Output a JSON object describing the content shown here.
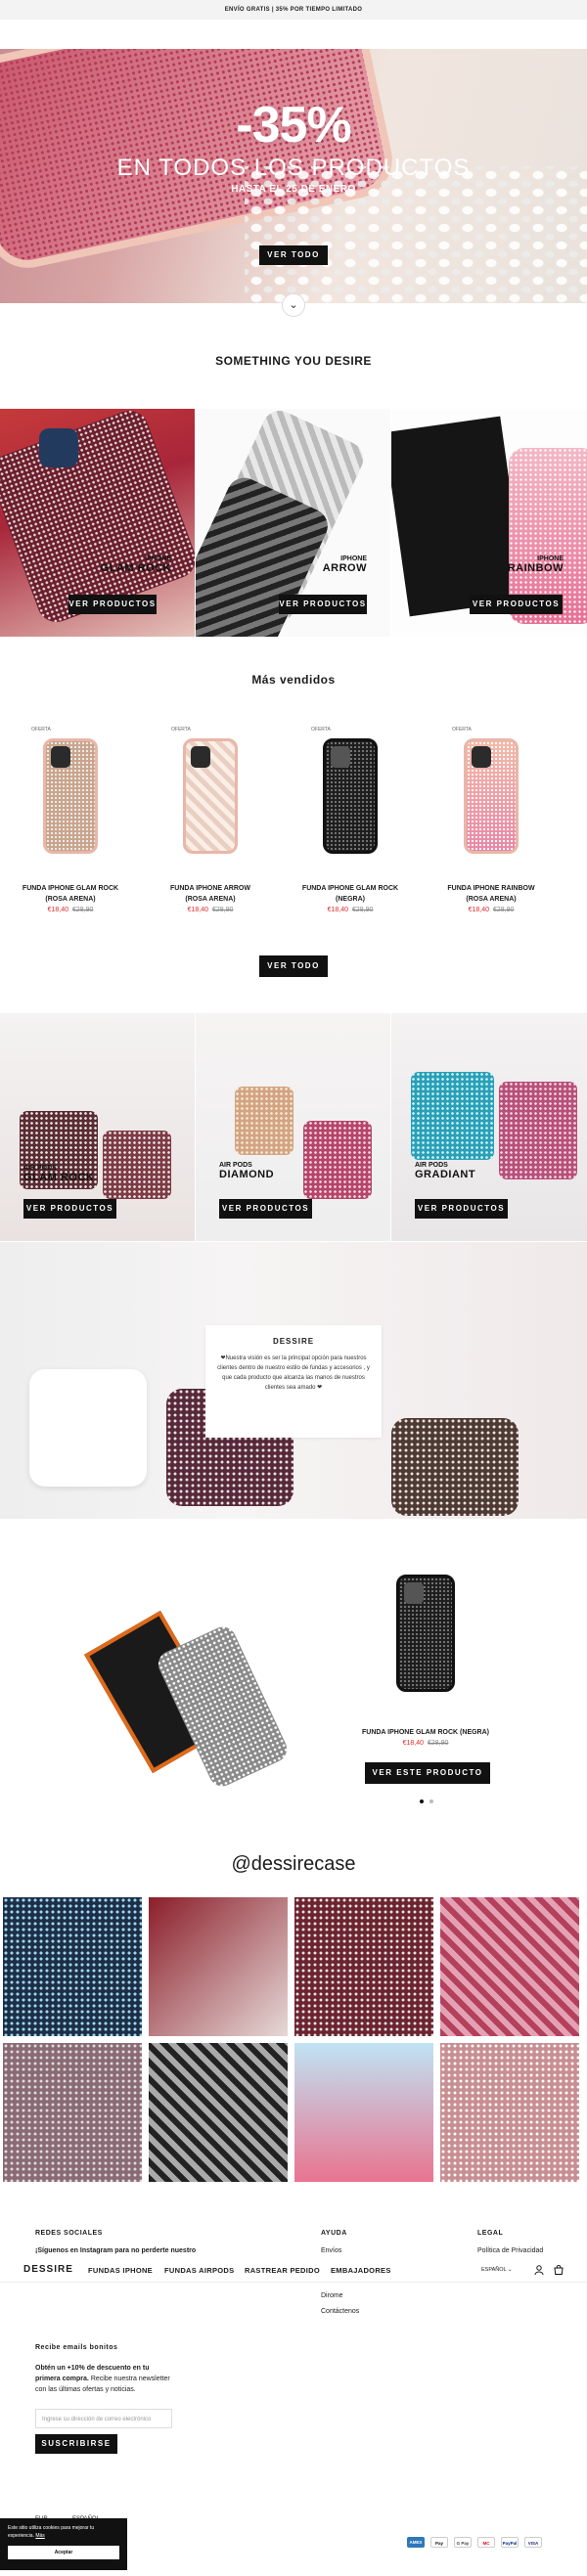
{
  "announcement": "ENVÍO GRATIS | 35% POR TIEMPO LIMITADO",
  "hero": {
    "discount": "-35%",
    "headline": "EN TODOS LOS PRODUCTOS",
    "subline": "HASTA EL 25 DE ENERO",
    "cta": "VER TODO"
  },
  "collections": {
    "title": "SOMETHING YOU DESIRE",
    "tiles": [
      {
        "small": "IPHONE",
        "big": "GLAM ROCK",
        "cta": "VER PRODUCTOS"
      },
      {
        "small": "IPHONE",
        "big": "ARROW",
        "cta": "VER PRODUCTOS"
      },
      {
        "small": "IPHONE",
        "big": "RAINBOW",
        "cta": "VER PRODUCTOS"
      }
    ]
  },
  "bestsellers": {
    "title": "Más vendidos",
    "badge": "OFERTA",
    "products": [
      {
        "name": "FUNDA IPHONE GLAM ROCK (ROSA ARENA)",
        "price": "€18,40",
        "old_price": "€28,90"
      },
      {
        "name": "FUNDA IPHONE ARROW (ROSA ARENA)",
        "price": "€18,40",
        "old_price": "€28,90"
      },
      {
        "name": "FUNDA IPHONE GLAM ROCK (NEGRA)",
        "price": "€18,40",
        "old_price": "€28,90"
      },
      {
        "name": "FUNDA IPHONE RAINBOW (ROSA ARENA)",
        "price": "€18,40",
        "old_price": "€28,90"
      }
    ],
    "cta": "VER TODO"
  },
  "airpods": {
    "tiles": [
      {
        "small": "AIR PODS",
        "big": "GLAM ROCK",
        "cta": "VER PRODUCTOS"
      },
      {
        "small": "AIR PODS",
        "big": "DIAMOND",
        "cta": "VER PRODUCTOS"
      },
      {
        "small": "AIR PODS",
        "big": "GRADIANT",
        "cta": "VER PRODUCTOS"
      }
    ]
  },
  "about": {
    "title": "DESSIRE",
    "text": "❤Nuestra visión es ser la principal opción para nuestros clientes dentro de nuestro estilo de fundas y accesorios , y que cada producto que alcanza las manos de nuestros clientes sea amado ❤"
  },
  "featured": {
    "name": "FUNDA IPHONE GLAM ROCK (NEGRA)",
    "price": "€18,40",
    "old_price": "€28,90",
    "cta": "VER ESTE PRODUCTO"
  },
  "instagram": {
    "handle": "@dessirecase"
  },
  "footer": {
    "social": {
      "title": "REDES SOCIALES",
      "text": "¡Síguenos en Instagram para no perderte nuestro"
    },
    "help": {
      "title": "AYUDA",
      "links": [
        "Envíos",
        "Devoluciones",
        "Contacto",
        "Dirome",
        "Contáctenos"
      ]
    },
    "legal": {
      "title": "LEGAL",
      "links": [
        "Política de Privacidad"
      ]
    },
    "newsletter": {
      "title": "Recibe emails bonitos",
      "text_bold": "Obtén un +10% de descuento en tu primera compra.",
      "text": "Recibe nuestra newsletter con las últimas ofertas y noticias.",
      "placeholder": "Ingrese su dirección de correo electrónico",
      "cta": "SUSCRIBIRSE"
    },
    "currency": "EUR ⌄",
    "language": "ESPAÑOL ⌄",
    "payments": [
      "AMEX",
      "Pay",
      "G Pay",
      "MC",
      "PayPal",
      "VISA"
    ]
  },
  "navbar": {
    "logo": "DESSIRE",
    "items": [
      "FUNDAS IPHONE",
      "FUNDAS AIRPODS",
      "RASTREAR PEDIDO",
      "EMBAJADORES"
    ],
    "language": "ESPAÑOL ⌄"
  },
  "cookie": {
    "text": "Este sitio utiliza cookies para mejorar tu experiencia.",
    "link": "Más",
    "accept": "Aceptar"
  }
}
